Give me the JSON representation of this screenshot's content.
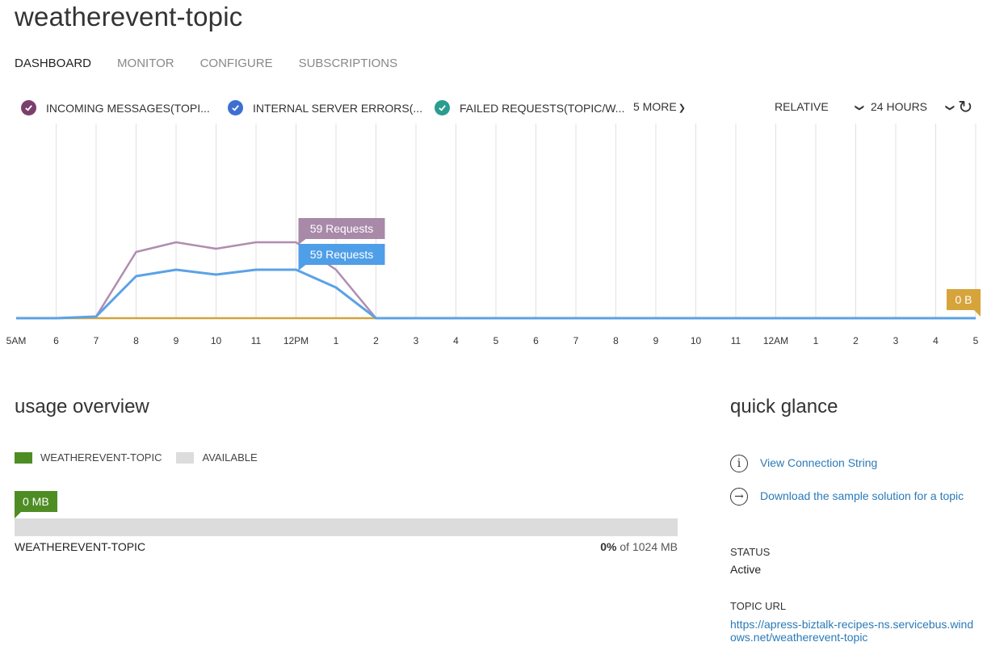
{
  "page": {
    "title": "weatherevent-topic"
  },
  "tabs": [
    {
      "label": "DASHBOARD",
      "active": true
    },
    {
      "label": "MONITOR",
      "active": false
    },
    {
      "label": "CONFIGURE",
      "active": false
    },
    {
      "label": "SUBSCRIPTIONS",
      "active": false
    }
  ],
  "metrics": [
    {
      "label": "INCOMING MESSAGES(TOPI...",
      "color": "#7b3f6e"
    },
    {
      "label": "INTERNAL SERVER ERRORS(...",
      "color": "#3c6fd1"
    },
    {
      "label": "FAILED REQUESTS(TOPIC/W...",
      "color": "#2a9d8f"
    }
  ],
  "more_label": "5 MORE",
  "range_mode": "RELATIVE",
  "range_period": "24 HOURS",
  "chart_data": {
    "type": "line",
    "categories": [
      "5AM",
      "6",
      "7",
      "8",
      "9",
      "10",
      "11",
      "12PM",
      "1",
      "2",
      "3",
      "4",
      "5",
      "6",
      "7",
      "8",
      "9",
      "10",
      "11",
      "12AM",
      "1",
      "2",
      "3",
      "4",
      "5"
    ],
    "series": [
      {
        "color": "#b08db0",
        "values": [
          0,
          0,
          1,
          41,
          47,
          43,
          47,
          47,
          30,
          0,
          0,
          0,
          0,
          0,
          0,
          0,
          0,
          0,
          0,
          0,
          0,
          0,
          0,
          0,
          0
        ]
      },
      {
        "color": "#5ba2e6",
        "values": [
          0,
          0,
          1,
          26,
          30,
          27,
          30,
          30,
          19,
          0,
          0,
          0,
          0,
          0,
          0,
          0,
          0,
          0,
          0,
          0,
          0,
          0,
          0,
          0,
          0
        ]
      },
      {
        "color": "#d4a23a",
        "values": [
          0,
          0,
          0,
          0,
          0,
          0,
          0,
          0,
          0,
          0,
          0,
          0,
          0,
          0,
          0,
          0,
          0,
          0,
          0,
          0,
          0,
          0,
          0,
          0,
          0
        ]
      }
    ],
    "tooltips": [
      {
        "text": "59 Requests",
        "color": "#a889a8",
        "series": 0,
        "x": "12PM"
      },
      {
        "text": "59 Requests",
        "color": "#4f9ee8",
        "series": 1,
        "x": "12PM"
      },
      {
        "text": "0 B",
        "color": "#d6a43b",
        "series": 2,
        "x": "5"
      }
    ]
  },
  "usage": {
    "title": "usage overview",
    "legend": [
      {
        "label": "WEATHEREVENT-TOPIC",
        "color": "#4e8d24"
      },
      {
        "label": "AVAILABLE",
        "color": "#dcdcdc"
      }
    ],
    "used_label": "0 MB",
    "used_fraction": 0,
    "name": "WEATHEREVENT-TOPIC",
    "pct": "0%",
    "of": "of 1024 MB"
  },
  "glance": {
    "title": "quick glance",
    "links": [
      {
        "icon": "info-icon",
        "text": "View Connection String"
      },
      {
        "icon": "arrow-right-circle-icon",
        "text": "Download the sample solution for a topic"
      }
    ],
    "status_label": "STATUS",
    "status_value": "Active",
    "url_label": "TOPIC URL",
    "url_value": "https://apress-biztalk-recipes-ns.servicebus.windows.net/weatherevent-topic"
  }
}
